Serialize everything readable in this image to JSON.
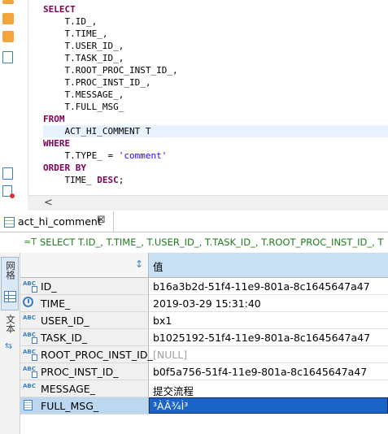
{
  "editor": {
    "sql_lines": [
      {
        "text": "SELECT",
        "kind": "kw"
      },
      {
        "text": "    T.ID_,",
        "kind": "plain"
      },
      {
        "text": "    T.TIME_,",
        "kind": "plain"
      },
      {
        "text": "    T.USER_ID_,",
        "kind": "plain"
      },
      {
        "text": "    T.TASK_ID_,",
        "kind": "plain"
      },
      {
        "text": "    T.ROOT_PROC_INST_ID_,",
        "kind": "plain"
      },
      {
        "text": "    T.PROC_INST_ID_,",
        "kind": "plain"
      },
      {
        "text": "    T.MESSAGE_,",
        "kind": "plain"
      },
      {
        "text": "    T.FULL_MSG_",
        "kind": "plain"
      },
      {
        "text": "FROM",
        "kind": "kw"
      },
      {
        "text": "    ACT_HI_COMMENT T",
        "kind": "plain"
      },
      {
        "text": "WHERE",
        "kind": "kw"
      },
      {
        "text": "    T.TYPE_ = ",
        "kind": "plain",
        "string": "'comment'"
      },
      {
        "text": "ORDER BY",
        "kind": "kw"
      },
      {
        "text": "    TIME_ ",
        "kind": "plain",
        "keyword_suffix": "DESC",
        "tail": ";"
      }
    ],
    "scroll_left_arrow": "<"
  },
  "results_tab": {
    "label": "act_hi_comment",
    "close": "⊠"
  },
  "sql_preview": {
    "icon": "≈T",
    "text": "SELECT T.ID_, T.TIME_, T.USER_ID_, T.TASK_ID_, T.ROOT_PROC_INST_ID_, T"
  },
  "sidebar": {
    "grid_label": "网格",
    "text_label": "文本"
  },
  "grid": {
    "value_header": "值",
    "sort_icon": "↕",
    "rows": [
      {
        "name": "ID_",
        "value": "b16a3b2d-51f4-11e9-801a-8c1645647a47",
        "type_icon": "abc-key"
      },
      {
        "name": "TIME_",
        "value": "2019-03-29 15:31:40",
        "type_icon": "clock"
      },
      {
        "name": "USER_ID_",
        "value": "bx1",
        "type_icon": "abc"
      },
      {
        "name": "TASK_ID_",
        "value": "b1025192-51f4-11e9-801a-8c1645647a47",
        "type_icon": "abc-key"
      },
      {
        "name": "ROOT_PROC_INST_ID_",
        "value": "[NULL]",
        "type_icon": "abc-key"
      },
      {
        "name": "PROC_INST_ID_",
        "value": "b0f5a756-51f4-11e9-801a-8c1645647a47",
        "type_icon": "abc-key"
      },
      {
        "name": "MESSAGE_",
        "value": "提交流程",
        "type_icon": "abc"
      },
      {
        "name": "FULL_MSG_",
        "value": "³ÀÂ¾Ì³",
        "type_icon": "doc"
      }
    ]
  }
}
